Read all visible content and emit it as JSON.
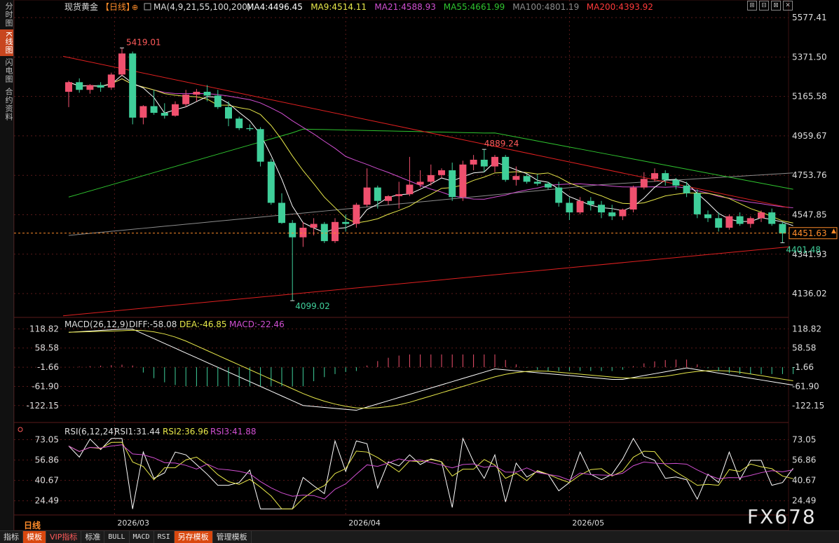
{
  "left_tabs": [
    "分时图",
    "K线图",
    "闪电图",
    "合约资料"
  ],
  "main": {
    "title": "现货黄金",
    "period": "【日线】",
    "ma_params": "MA(4,9,21,55,100,200)",
    "ma_values": [
      {
        "label": "MA4:4496.45",
        "color": "#ffffff"
      },
      {
        "label": "MA9:4514.11",
        "color": "#e8e84a"
      },
      {
        "label": "MA21:4588.93",
        "color": "#d14fd1"
      },
      {
        "label": "MA55:4661.99",
        "color": "#2fc42f"
      },
      {
        "label": "MA100:4801.19",
        "color": "#8c8c8c"
      },
      {
        "label": "MA200:4393.92",
        "color": "#ff3a3a"
      }
    ],
    "price_ticks": [
      "5577.41",
      "5371.50",
      "5165.58",
      "4959.67",
      "4753.76",
      "4547.85",
      "4341.93",
      "4136.02"
    ],
    "current_price": "4451.63",
    "annotations": [
      {
        "text": "5419.01",
        "color": "#ff5a5a"
      },
      {
        "text": "4889.24",
        "color": "#ff5a5a"
      },
      {
        "text": "4099.02",
        "color": "#3fcf9a"
      },
      {
        "text": "4401.48",
        "color": "#3fcf9a"
      }
    ]
  },
  "macd": {
    "title": "MACD(26,12,9)",
    "diff": "DIFF:-58.08",
    "dea": "DEA:-46.85",
    "macd": "MACD:-22.46",
    "ticks": [
      "118.82",
      "58.58",
      "-1.66",
      "-61.90",
      "-122.15"
    ]
  },
  "rsi": {
    "title": "RSI(6,12,24)",
    "rsi1": "RSI1:31.44",
    "rsi2": "RSI2:36.96",
    "rsi3": "RSI3:41.88",
    "ticks": [
      "73.05",
      "56.86",
      "40.67",
      "24.49"
    ]
  },
  "x_ticks": [
    "2026/03",
    "2026/04",
    "2026/05"
  ],
  "period_label": "日线",
  "bottom_tabs": [
    "指标",
    "模板",
    "VIP指标",
    "标准",
    "BULL",
    "MACD",
    "RSI",
    "另存模板",
    "管理模板"
  ],
  "watermark": "FX678",
  "colors": {
    "up": "#f0506e",
    "down": "#3fcf9a",
    "bg": "#000000",
    "accent": "#d9480f"
  },
  "chart_data": {
    "type": "candlestick",
    "ylim": [
      4030,
      5640
    ],
    "candles": [
      [
        5190,
        5248,
        5110,
        5240
      ],
      [
        5240,
        5260,
        5185,
        5200
      ],
      [
        5200,
        5230,
        5180,
        5225
      ],
      [
        5225,
        5240,
        5190,
        5212
      ],
      [
        5212,
        5290,
        5200,
        5280
      ],
      [
        5280,
        5419,
        5270,
        5390
      ],
      [
        5390,
        5400,
        5020,
        5055
      ],
      [
        5055,
        5120,
        5020,
        5115
      ],
      [
        5115,
        5200,
        5070,
        5080
      ],
      [
        5080,
        5130,
        5050,
        5065
      ],
      [
        5065,
        5140,
        5060,
        5125
      ],
      [
        5125,
        5200,
        5110,
        5175
      ],
      [
        5175,
        5205,
        5140,
        5190
      ],
      [
        5190,
        5225,
        5140,
        5170
      ],
      [
        5170,
        5200,
        5100,
        5110
      ],
      [
        5110,
        5140,
        5010,
        5050
      ],
      [
        5050,
        5060,
        4990,
        5000
      ],
      [
        5000,
        5020,
        4985,
        4995
      ],
      [
        4995,
        5005,
        4800,
        4825
      ],
      [
        4825,
        4840,
        4600,
        4610
      ],
      [
        4610,
        4660,
        4500,
        4505
      ],
      [
        4505,
        4520,
        4099,
        4430
      ],
      [
        4430,
        4510,
        4380,
        4480
      ],
      [
        4480,
        4530,
        4440,
        4500
      ],
      [
        4500,
        4510,
        4400,
        4410
      ],
      [
        4410,
        4530,
        4400,
        4510
      ],
      [
        4510,
        4550,
        4460,
        4500
      ],
      [
        4500,
        4610,
        4480,
        4600
      ],
      [
        4600,
        4790,
        4590,
        4690
      ],
      [
        4690,
        4700,
        4580,
        4620
      ],
      [
        4620,
        4650,
        4600,
        4645
      ],
      [
        4645,
        4720,
        4580,
        4655
      ],
      [
        4655,
        4850,
        4645,
        4705
      ],
      [
        4705,
        4780,
        4690,
        4720
      ],
      [
        4720,
        4810,
        4700,
        4755
      ],
      [
        4755,
        4790,
        4740,
        4780
      ],
      [
        4780,
        4820,
        4620,
        4640
      ],
      [
        4640,
        4830,
        4620,
        4810
      ],
      [
        4810,
        4860,
        4780,
        4835
      ],
      [
        4835,
        4889,
        4770,
        4800
      ],
      [
        4800,
        4860,
        4770,
        4850
      ],
      [
        4850,
        4860,
        4720,
        4730
      ],
      [
        4730,
        4800,
        4700,
        4750
      ],
      [
        4750,
        4760,
        4710,
        4720
      ],
      [
        4720,
        4760,
        4700,
        4710
      ],
      [
        4710,
        4720,
        4680,
        4690
      ],
      [
        4690,
        4720,
        4590,
        4610
      ],
      [
        4610,
        4640,
        4520,
        4560
      ],
      [
        4560,
        4640,
        4550,
        4620
      ],
      [
        4620,
        4640,
        4570,
        4600
      ],
      [
        4600,
        4620,
        4530,
        4560
      ],
      [
        4560,
        4600,
        4520,
        4540
      ],
      [
        4540,
        4580,
        4520,
        4575
      ],
      [
        4575,
        4700,
        4560,
        4690
      ],
      [
        4690,
        4770,
        4680,
        4735
      ],
      [
        4735,
        4790,
        4720,
        4765
      ],
      [
        4765,
        4780,
        4700,
        4730
      ],
      [
        4730,
        4740,
        4680,
        4700
      ],
      [
        4700,
        4720,
        4640,
        4660
      ],
      [
        4660,
        4680,
        4530,
        4550
      ],
      [
        4550,
        4570,
        4510,
        4530
      ],
      [
        4530,
        4560,
        4460,
        4480
      ],
      [
        4480,
        4550,
        4470,
        4540
      ],
      [
        4540,
        4560,
        4490,
        4500
      ],
      [
        4500,
        4540,
        4480,
        4530
      ],
      [
        4530,
        4570,
        4510,
        4560
      ],
      [
        4560,
        4580,
        4490,
        4500
      ],
      [
        4500,
        4510,
        4401,
        4450
      ],
      [
        4450,
        4460,
        4445,
        4451.63
      ]
    ]
  }
}
